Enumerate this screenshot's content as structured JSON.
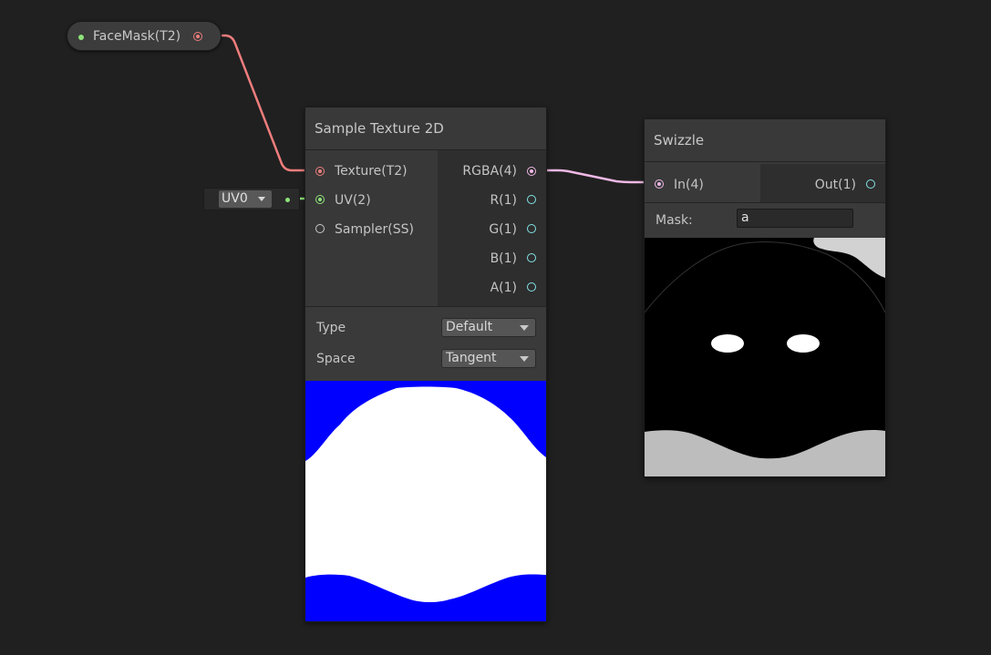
{
  "property_node": {
    "label": "FaceMask(T2)"
  },
  "uv_inline": {
    "value": "UV0"
  },
  "sample_texture": {
    "title": "Sample Texture 2D",
    "inputs": [
      {
        "label": "Texture(T2)"
      },
      {
        "label": "UV(2)"
      },
      {
        "label": "Sampler(SS)"
      }
    ],
    "outputs": [
      {
        "label": "RGBA(4)"
      },
      {
        "label": "R(1)"
      },
      {
        "label": "G(1)"
      },
      {
        "label": "B(1)"
      },
      {
        "label": "A(1)"
      }
    ],
    "settings": {
      "type_label": "Type",
      "type_value": "Default",
      "space_label": "Space",
      "space_value": "Tangent"
    }
  },
  "swizzle": {
    "title": "Swizzle",
    "input_label": "In(4)",
    "output_label": "Out(1)",
    "mask_label": "Mask:",
    "mask_value": "a"
  },
  "colors": {
    "background": "#202020",
    "texture_wire": "#ef7d7d",
    "uv_wire": "#8ee37a",
    "vector4_wire": "#f0b9e6",
    "float_port": "#84e4e7",
    "preview_blue": "#0000ff"
  },
  "icons": [
    "dropdown-arrow-icon",
    "port-dot-icon"
  ]
}
